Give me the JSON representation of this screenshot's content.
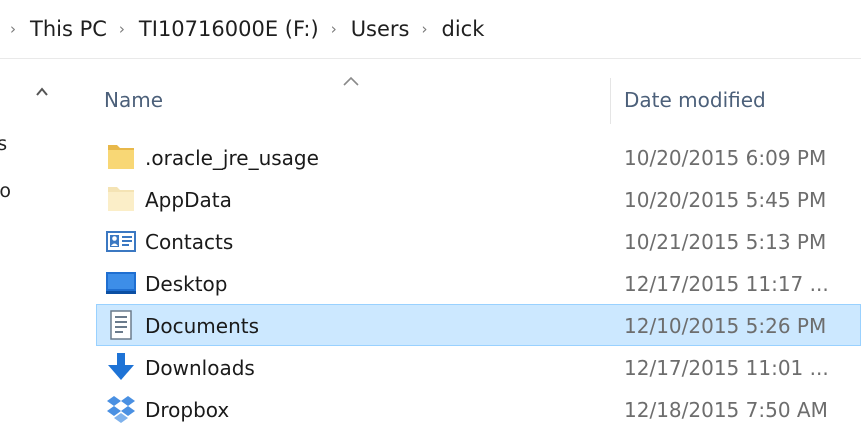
{
  "breadcrumb": {
    "items": [
      "This PC",
      "TI10716000E (F:)",
      "Users",
      "dick"
    ]
  },
  "nav_pane": {
    "scroll_up_glyph": "^",
    "fragments": [
      "is",
      "ro"
    ]
  },
  "columns": {
    "name": "Name",
    "date_modified": "Date modified",
    "sorted_by": "Name"
  },
  "files": [
    {
      "name": ".oracle_jre_usage",
      "date": "10/20/2015 6:09 PM",
      "icon": "folder-icon",
      "selected": false
    },
    {
      "name": "AppData",
      "date": "10/20/2015 5:45 PM",
      "icon": "hidden-folder-icon",
      "selected": false
    },
    {
      "name": "Contacts",
      "date": "10/21/2015 5:13 PM",
      "icon": "contacts-icon",
      "selected": false
    },
    {
      "name": "Desktop",
      "date": "12/17/2015 11:17 ...",
      "icon": "desktop-icon",
      "selected": false
    },
    {
      "name": "Documents",
      "date": "12/10/2015 5:26 PM",
      "icon": "documents-icon",
      "selected": true
    },
    {
      "name": "Downloads",
      "date": "12/17/2015 11:01 ...",
      "icon": "downloads-icon",
      "selected": false
    },
    {
      "name": "Dropbox",
      "date": "12/18/2015 7:50 AM",
      "icon": "dropbox-icon",
      "selected": false
    }
  ],
  "colors": {
    "selection_fill": "#cce8ff",
    "selection_border": "#99d1ff",
    "header_text": "#4c607a",
    "folder_yellow": "#f8d775"
  }
}
